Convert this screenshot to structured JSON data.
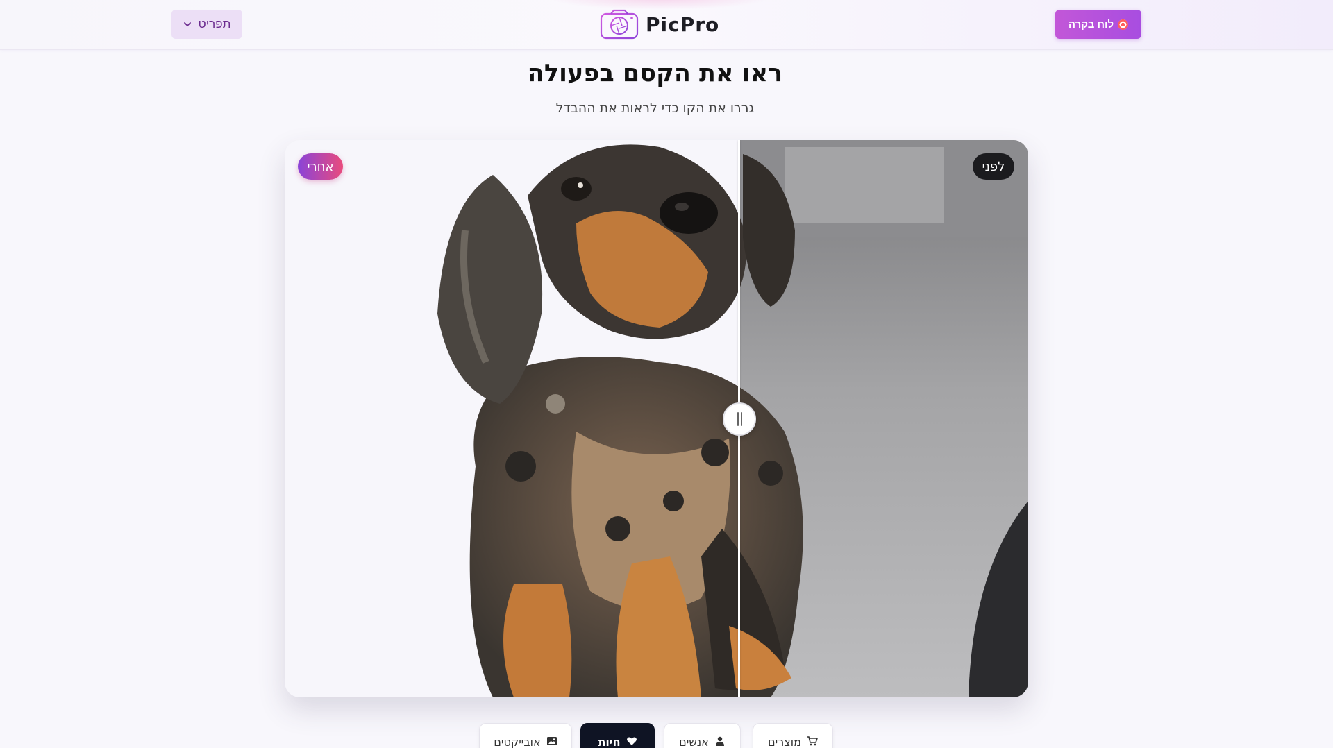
{
  "header": {
    "menu_label": "תפריט",
    "logo_text": "PicPro",
    "board_button_label": "לוח בקרה"
  },
  "hero": {
    "title": "ראו את הקסם בפעולה",
    "subtitle": "גררו את הקו כדי לראות את ההבדל"
  },
  "compare": {
    "after_label": "אחרי",
    "before_label": "לפני",
    "slider_position_percent": 50
  },
  "tabs": [
    {
      "label": "מוצרים",
      "icon": "cart-icon",
      "active": false
    },
    {
      "label": "אנשים",
      "icon": "user-icon",
      "active": false
    },
    {
      "label": "חיות",
      "icon": "heart-icon",
      "active": true
    },
    {
      "label": "אובייקטים",
      "icon": "image-icon",
      "active": false
    }
  ],
  "colors": {
    "accent": "#b052dc",
    "after_badge_gradient": [
      "#8a44d8",
      "#e94b7d"
    ],
    "active_tab": "#0f1424"
  }
}
